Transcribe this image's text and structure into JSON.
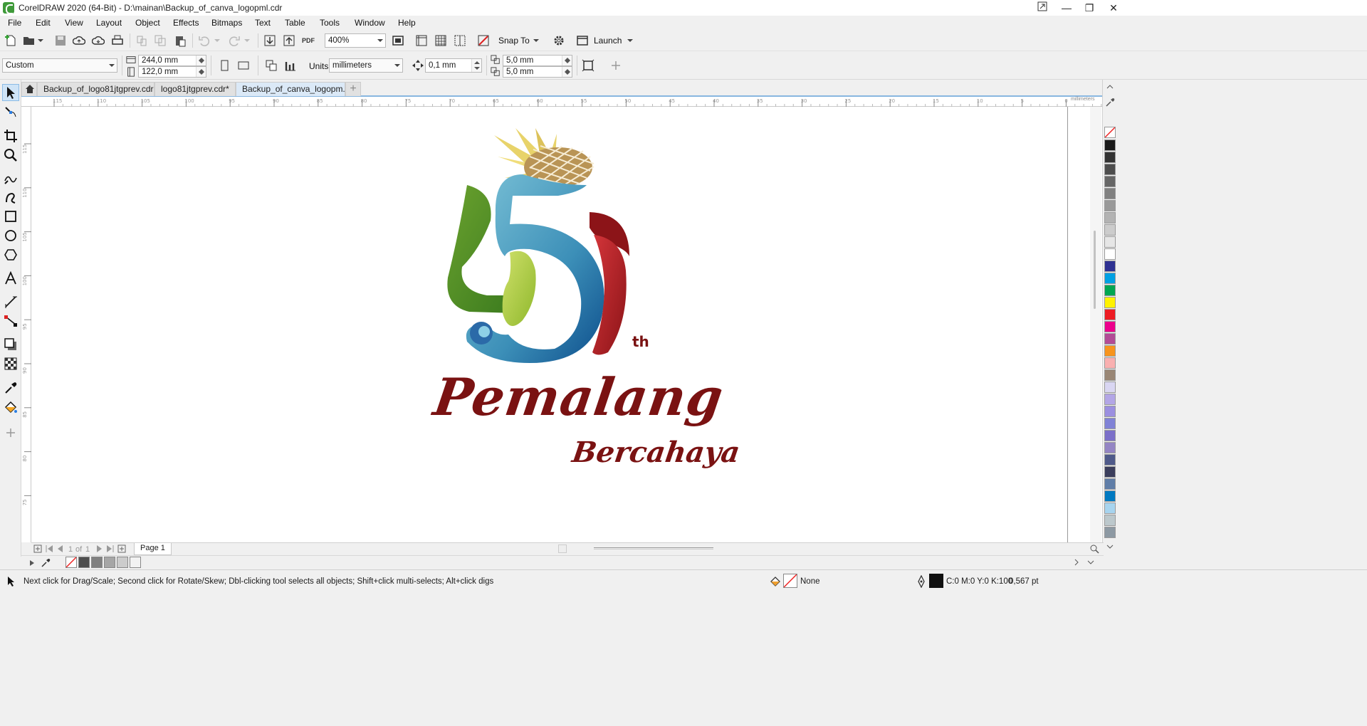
{
  "window": {
    "title": "CorelDRAW 2020 (64-Bit) - D:\\mainan\\Backup_of_canva_logopml.cdr",
    "minimize": "—",
    "maximize": "❐",
    "close": "✕"
  },
  "menu": [
    "File",
    "Edit",
    "View",
    "Layout",
    "Object",
    "Effects",
    "Bitmaps",
    "Text",
    "Table",
    "Tools",
    "Window",
    "Help"
  ],
  "toolbar": {
    "zoom_value": "400%",
    "snap_to": "Snap To",
    "launch": "Launch",
    "pdf_label": "PDF"
  },
  "propertybar": {
    "page_preset": "Custom",
    "width": "244,0 mm",
    "height": "122,0 mm",
    "units_label": "Units:",
    "units_value": "millimeters",
    "nudge": "0,1 mm",
    "dup_x": "5,0 mm",
    "dup_y": "5,0 mm"
  },
  "tabs": [
    {
      "label": "Backup_of_logo81jtgprev.cdr"
    },
    {
      "label": "logo81jtgprev.cdr*"
    },
    {
      "label": "Backup_of_canva_logopm..."
    }
  ],
  "rulers": {
    "h_ticks": [
      "115",
      "110",
      "105",
      "100",
      "95",
      "90",
      "85",
      "80",
      "75",
      "70",
      "65",
      "60",
      "55",
      "50",
      "45",
      "40",
      "35",
      "30",
      "25",
      "20",
      "15",
      "10",
      "5",
      "0"
    ],
    "v_ticks": [
      "115",
      "110",
      "105",
      "100",
      "95",
      "90",
      "85",
      "80",
      "75"
    ],
    "units": "millimeters"
  },
  "artwork": {
    "main_text": "Pemalang",
    "sub_text": "Bercahaya",
    "th_text": "th"
  },
  "pagenav": {
    "current": "1",
    "of_label": "of",
    "total": "1",
    "page_tab": "Page 1"
  },
  "palette_colors": [
    "#1a1a1a",
    "#333333",
    "#4d4d4d",
    "#666666",
    "#808080",
    "#999999",
    "#b3b3b3",
    "#cccccc",
    "#e6e6e6",
    "#ffffff",
    "#2e3192",
    "#00a0e3",
    "#00a651",
    "#fff200",
    "#ed1c24",
    "#ec008c",
    "#b34b96",
    "#f7941d",
    "#f9b0b0",
    "#998675",
    "#d9d6f2",
    "#b3a6e6",
    "#9b8fe0",
    "#8082d6",
    "#7b6fc9",
    "#9485c4",
    "#4f5a8a",
    "#3b3e5c",
    "#607ea8",
    "#0079c1",
    "#a7d4ef",
    "#bcc8cc",
    "#8d99a3"
  ],
  "docpal_colors": [
    "#4d4d4d",
    "#808080",
    "#a6a6a6",
    "#cccccc",
    "#f2f2f2"
  ],
  "status": {
    "hint": "Next click for Drag/Scale; Second click for Rotate/Skew; Dbl-clicking tool selects all objects; Shift+click multi-selects; Alt+click digs",
    "fill_label": "None",
    "outline_color": "C:0 M:0 Y:0 K:100",
    "outline_width": "0,567 pt"
  }
}
